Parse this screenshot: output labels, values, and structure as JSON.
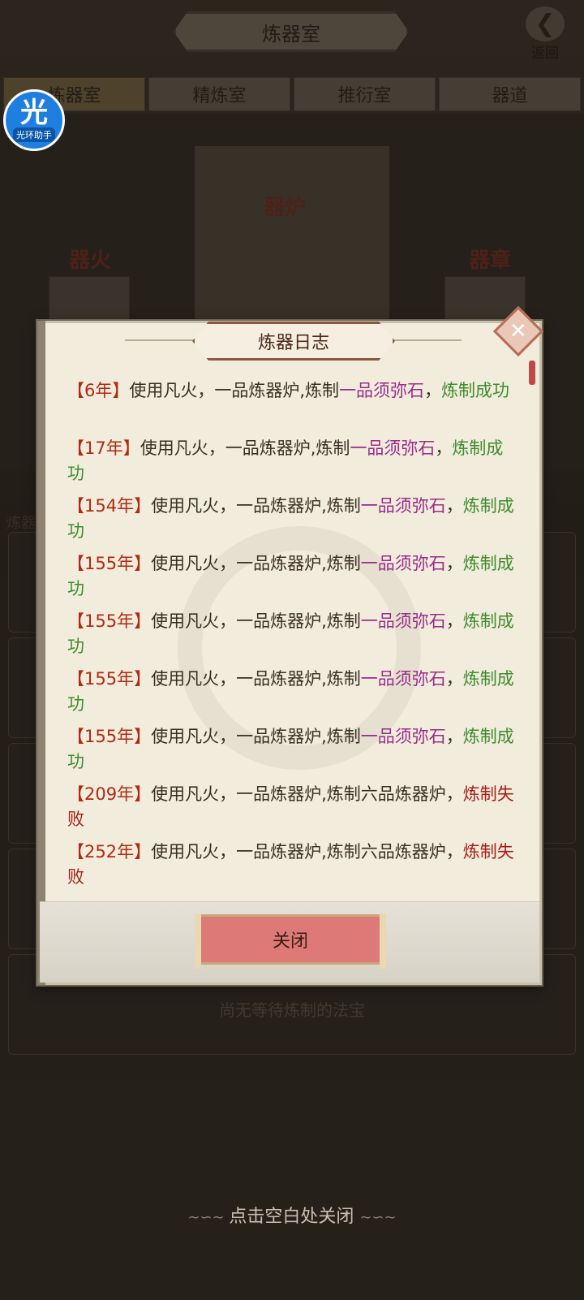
{
  "header": {
    "title": "炼器室",
    "back_label": "返回",
    "back_icon": "back-arrow-icon"
  },
  "tabs": [
    {
      "label": "炼器室"
    },
    {
      "label": "精炼室"
    },
    {
      "label": "推衍室"
    },
    {
      "label": "器道"
    }
  ],
  "helper": {
    "glyph": "光",
    "label": "光环助手"
  },
  "scene": {
    "furnace": "器炉",
    "fire": "器火",
    "blueprint": "器章",
    "side_label": "炼器"
  },
  "empty_text": "尚无等待炼制的法宝",
  "dialog": {
    "title": "炼器日志",
    "close_button": "关闭",
    "entries": [
      {
        "year": "【6年】",
        "text": "使用凡火，一品炼器炉,炼制",
        "item": "一品须弥石",
        "sep": "，",
        "result": "炼制成功",
        "success": true
      },
      {
        "year": "【17年】",
        "text": "使用凡火，一品炼器炉,炼制",
        "item": "一品须弥石",
        "sep": "，",
        "result": "炼制成功",
        "success": true
      },
      {
        "year": "【154年】",
        "text": "使用凡火，一品炼器炉,炼制",
        "item": "一品须弥石",
        "sep": "，",
        "result": "炼制成功",
        "success": true
      },
      {
        "year": "【155年】",
        "text": "使用凡火，一品炼器炉,炼制",
        "item": "一品须弥石",
        "sep": "，",
        "result": "炼制成功",
        "success": true
      },
      {
        "year": "【155年】",
        "text": "使用凡火，一品炼器炉,炼制",
        "item": "一品须弥石",
        "sep": "，",
        "result": "炼制成功",
        "success": true
      },
      {
        "year": "【155年】",
        "text": "使用凡火，一品炼器炉,炼制",
        "item": "一品须弥石",
        "sep": "，",
        "result": "炼制成功",
        "success": true
      },
      {
        "year": "【155年】",
        "text": "使用凡火，一品炼器炉,炼制",
        "item": "一品须弥石",
        "sep": "，",
        "result": "炼制成功",
        "success": true
      },
      {
        "year": "【209年】",
        "text": "使用凡火，一品炼器炉,炼制",
        "item": "六品炼器炉",
        "sep": "，",
        "result": "炼制失败",
        "success": false
      },
      {
        "year": "【252年】",
        "text": "使用凡火，一品炼器炉,炼制",
        "item": "六品炼器炉",
        "sep": "，",
        "result": "炼制失败",
        "success": false
      }
    ]
  },
  "hint": "点击空白处关闭"
}
